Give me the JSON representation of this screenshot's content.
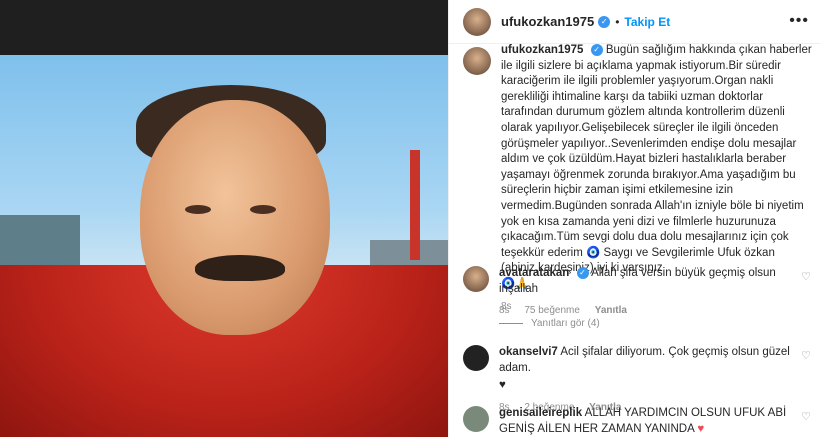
{
  "header": {
    "username": "ufukozkan1975",
    "separator": "•",
    "follow_label": "Takip Et",
    "more_label": "•••"
  },
  "caption": {
    "username": "ufukozkan1975",
    "text": "Bugün sağlığım hakkında çıkan haberler ile ilgili sizlere bi açıklama yapmak istiyorum.Bir süredir karaciğerim ile ilgili problemler yaşıyorum.Organ nakli gerekliliği ihtimaline karşı da tabiiki uzman doktorlar tarafından durumum gözlem altında kontrollerim düzenli olarak yapılıyor.Gelişebilecek süreçler ile ilgili önceden görüşmeler yapılıyor..Sevenlerimden endişe dolu mesajlar aldım ve çok üzüldüm.Hayat bizleri hastalıklarla beraber yaşamayı öğrenmek zorunda bırakıyor.Ama yaşadığım bu süreçlerin hiçbir zaman işimi etkilemesine izin vermedim.Bugünden sonrada Allah'ın izniyle böle bi niyetim yok en kısa zamanda yeni dizi ve filmlerle huzurunuza çıkacağım.Tüm sevgi dolu dua dolu mesajlarınız için çok teşekkür ederim",
    "eye_emoji": "🧿",
    "signoff": "Saygı ve Sevgilerimle Ufuk özkan (abiniz,kardeşiniz) iyi ki varsınız",
    "end_emojis": "🧿🙏",
    "time": "8s"
  },
  "comments": [
    {
      "username": "avataratakan",
      "verified": true,
      "text": "Allah şifa versin büyük geçmiş olsun inşallah",
      "time": "8s",
      "likes": "75 beğenme",
      "reply_label": "Yanıtla",
      "heart": "♡"
    },
    {
      "username": "okanselvi7",
      "text": "Acil şifalar diliyorum. Çok geçmiş olsun güzel adam.",
      "extra": "♥",
      "time": "8s",
      "likes": "2 beğenme",
      "reply_label": "Yanıtla",
      "heart": "♡"
    },
    {
      "username": "genisaileireplik",
      "text": "ALLAH YARDIMCIN OLSUN UFUK ABİ GENİŞ AİLEN HER ZAMAN YANINDA",
      "extra": "♥",
      "heart": "♡"
    }
  ],
  "replies_toggle": "Yanıtları gör (4)"
}
